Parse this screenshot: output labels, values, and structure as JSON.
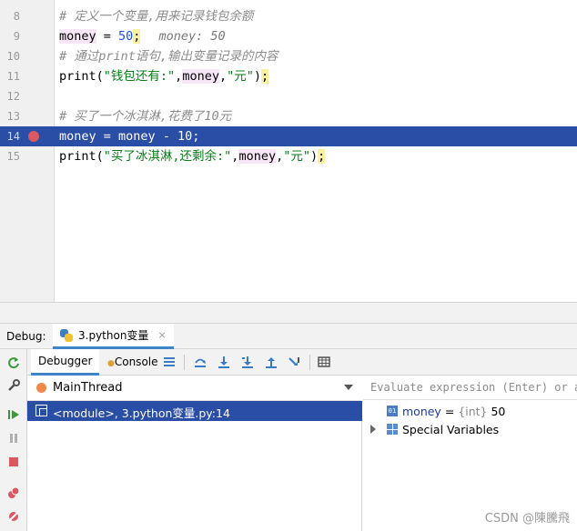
{
  "editor": {
    "lines": [
      {
        "num": "8",
        "parts": [
          {
            "t": "# 定义一个变量,用来记录钱包余额",
            "c": "cmt"
          }
        ]
      },
      {
        "num": "9",
        "parts": [
          {
            "t": "money",
            "c": "var-hl"
          },
          {
            "t": " = ",
            "c": ""
          },
          {
            "t": "50",
            "c": "num"
          },
          {
            "t": ";",
            "c": "paren-hl"
          },
          {
            "t": "money: 50",
            "c": "inline-val"
          }
        ]
      },
      {
        "num": "10",
        "parts": [
          {
            "t": "# 通过print语句,输出变量记录的内容",
            "c": "cmt"
          }
        ]
      },
      {
        "num": "11",
        "parts": [
          {
            "t": "print(",
            "c": ""
          },
          {
            "t": "\"钱包还有:\"",
            "c": "str"
          },
          {
            "t": ",",
            "c": ""
          },
          {
            "t": "money",
            "c": "var-hl"
          },
          {
            "t": ",",
            "c": ""
          },
          {
            "t": "\"元\"",
            "c": "str"
          },
          {
            "t": ")",
            "c": ""
          },
          {
            "t": ";",
            "c": "paren-hl"
          }
        ]
      },
      {
        "num": "12",
        "parts": []
      },
      {
        "num": "13",
        "parts": [
          {
            "t": "# 买了一个冰淇淋,花费了10元",
            "c": "cmt"
          }
        ]
      },
      {
        "num": "14",
        "current": true,
        "breakpoint": true,
        "parts": [
          {
            "t": "money = money - 10;",
            "c": ""
          }
        ]
      },
      {
        "num": "15",
        "parts": [
          {
            "t": "print(",
            "c": ""
          },
          {
            "t": "\"买了冰淇淋,还剩余:\"",
            "c": "str"
          },
          {
            "t": ",",
            "c": ""
          },
          {
            "t": "money",
            "c": "var-hl"
          },
          {
            "t": ",",
            "c": ""
          },
          {
            "t": "\"元\"",
            "c": "str"
          },
          {
            "t": ")",
            "c": ""
          },
          {
            "t": ";",
            "c": "paren-hl"
          }
        ]
      }
    ]
  },
  "debug": {
    "label": "Debug:",
    "run_tab": "3.python变量",
    "close_glyph": "×",
    "tabs": {
      "debugger": "Debugger",
      "console": "Console"
    },
    "thread": "MainThread",
    "frame": "<module>, 3.python变量.py:14",
    "eval_placeholder": "Evaluate expression (Enter) or add a watch (Ctrl+Shift+Enter)",
    "variables": [
      {
        "name": "money",
        "eq": " = ",
        "type": "{int}",
        "value": " 50",
        "icon": "01"
      }
    ],
    "special_vars": "Special Variables"
  },
  "watermark": "CSDN @陳騰飛",
  "colors": {
    "current_line": "#2a4ea6",
    "breakpoint": "#db5860",
    "tab_underline": "#4083c9"
  }
}
